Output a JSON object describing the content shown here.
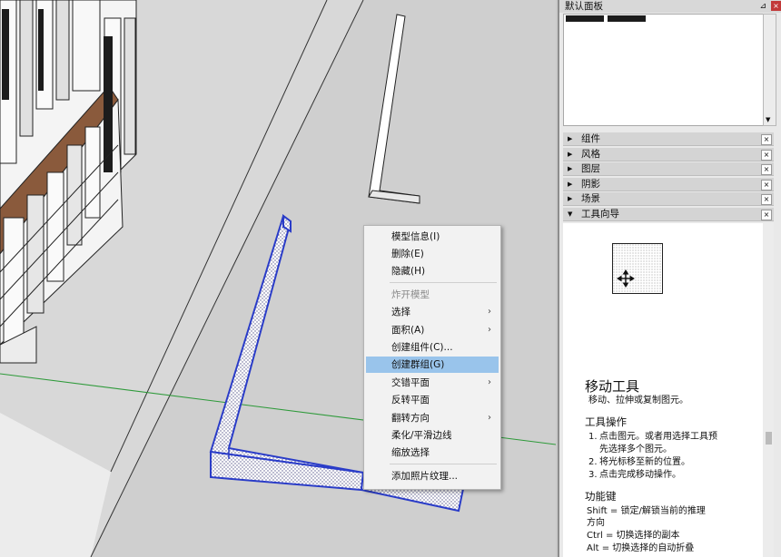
{
  "context_menu": {
    "items": [
      {
        "label": "模型信息(I)",
        "state": "normal"
      },
      {
        "label": "删除(E)",
        "state": "normal"
      },
      {
        "label": "隐藏(H)",
        "state": "normal"
      },
      {
        "label": "炸开模型",
        "state": "disabled"
      },
      {
        "label": "选择",
        "state": "submenu"
      },
      {
        "label": "面积(A)",
        "state": "submenu"
      },
      {
        "label": "创建组件(C)...",
        "state": "normal"
      },
      {
        "label": "创建群组(G)",
        "state": "highlighted"
      },
      {
        "label": "交错平面",
        "state": "submenu"
      },
      {
        "label": "反转平面",
        "state": "normal"
      },
      {
        "label": "翻转方向",
        "state": "submenu"
      },
      {
        "label": "柔化/平滑边线",
        "state": "normal"
      },
      {
        "label": "缩放选择",
        "state": "normal"
      },
      {
        "label": "添加照片纹理...",
        "state": "normal"
      }
    ],
    "submenu_arrow": "›"
  },
  "panel": {
    "title": "默认面板",
    "pin_icon": "⊿",
    "close_icon": "×",
    "trays": [
      {
        "label": "组件",
        "expanded": false
      },
      {
        "label": "风格",
        "expanded": false
      },
      {
        "label": "图层",
        "expanded": false
      },
      {
        "label": "阴影",
        "expanded": false
      },
      {
        "label": "场景",
        "expanded": false
      },
      {
        "label": "工具向导",
        "expanded": true
      }
    ],
    "tray_close": "×",
    "guide": {
      "title": "移动工具",
      "subtitle": "移动、拉伸或复制图元。",
      "ops_heading": "工具操作",
      "steps": [
        {
          "num": "1.",
          "text": "点击图元。或者用选择工具预"
        },
        {
          "num": "",
          "text": "先选择多个图元。"
        },
        {
          "num": "2.",
          "text": "将光标移至新的位置。"
        },
        {
          "num": "3.",
          "text": "点击完成移动操作。"
        }
      ],
      "func_heading": "功能键",
      "keys": [
        "Shift = 锁定/解锁当前的推理",
        "方向",
        "Ctrl = 切换选择的副本",
        "Alt = 切换选择的自动折叠"
      ]
    }
  },
  "colors": {
    "selection_blue": "#2a3cc8",
    "highlight": "#99c4eb",
    "axis_green": "#2e9a3a"
  }
}
